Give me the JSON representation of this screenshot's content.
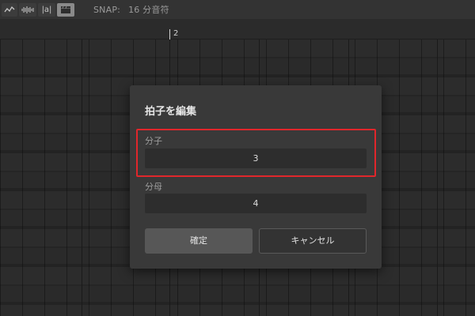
{
  "toolbar": {
    "buttons": [
      {
        "icon": "curve-icon",
        "active": false
      },
      {
        "icon": "waveform-icon",
        "active": false
      },
      {
        "icon": "text-label-icon",
        "label": "|a|",
        "active": false
      },
      {
        "icon": "clapperboard-icon",
        "active": true
      }
    ],
    "snap_label": "SNAP:",
    "snap_value": "16 分音符"
  },
  "ruler": {
    "bar_number": "2"
  },
  "dialog": {
    "title": "拍子を編集",
    "numerator_label": "分子",
    "numerator_value": "3",
    "denominator_label": "分母",
    "denominator_value": "4",
    "ok_label": "確定",
    "cancel_label": "キャンセル"
  },
  "colors": {
    "highlight": "#e0262b",
    "dialog_bg": "#393939",
    "toolbar_bg": "#333333"
  }
}
